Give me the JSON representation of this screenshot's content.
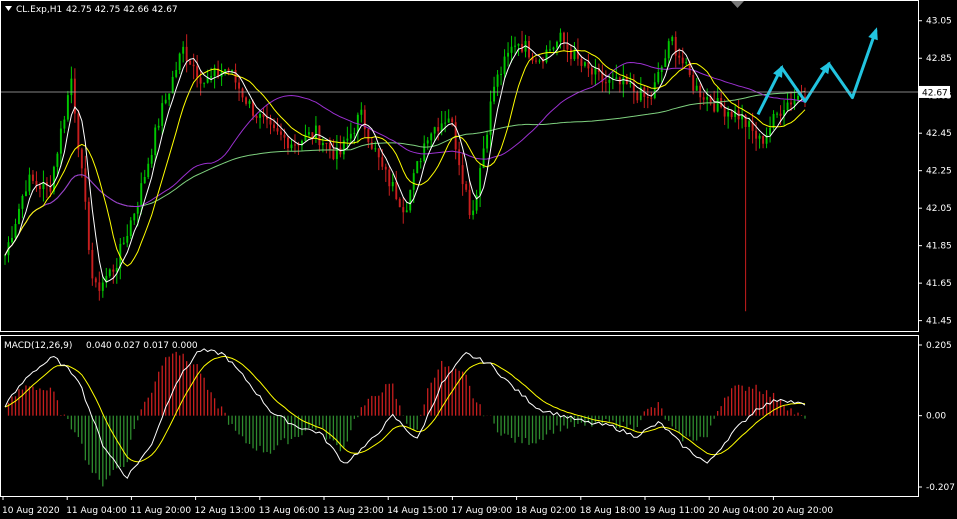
{
  "header": {
    "symbol_label": "CL.Exp,H1",
    "ohlc_label": "42.75 42.75 42.66 42.67"
  },
  "macd": {
    "label": "MACD(12,26,9)",
    "values_label": "0.040 0.027 0.017 0.000"
  },
  "current_price_label": "42.67",
  "colors": {
    "background": "#000000",
    "frame": "#ffffff",
    "bull_candle": "#00c800",
    "bear_candle": "#c81e1e",
    "fast_ma": "#ffffff",
    "slow_ma": "#ffff00",
    "ma_purple": "#9b30d0",
    "ma_green": "#7fd17f",
    "macd_line": "#ffffff",
    "signal_line": "#ffff00",
    "hist_pos": "#c81e1e",
    "hist_neg": "#2e8b2e",
    "forecast": "#22c4e0"
  },
  "chart_data": {
    "type": "candlestick",
    "price_axis_ticks": [
      "43.05",
      "42.85",
      "42.65",
      "42.45",
      "42.25",
      "42.05",
      "41.85",
      "41.65",
      "41.45"
    ],
    "price_range": [
      41.4,
      43.15
    ],
    "macd_axis_ticks": [
      "0.205",
      "0.00",
      "-0.207"
    ],
    "macd_range": [
      -0.207,
      0.205
    ],
    "time_labels": [
      "10 Aug 2020",
      "11 Aug 04:00",
      "11 Aug 20:00",
      "12 Aug 13:00",
      "13 Aug 06:00",
      "13 Aug 23:00",
      "14 Aug 15:00",
      "17 Aug 09:00",
      "18 Aug 02:00",
      "18 Aug 18:00",
      "19 Aug 11:00",
      "20 Aug 04:00",
      "20 Aug 20:00"
    ],
    "close_keypoints": [
      41.8,
      42.2,
      42.15,
      42.75,
      41.6,
      41.75,
      42.1,
      42.55,
      42.9,
      42.72,
      42.8,
      42.6,
      42.45,
      42.4,
      42.45,
      42.32,
      42.55,
      42.25,
      42.05,
      42.45,
      42.55,
      42.0,
      42.7,
      42.95,
      42.85,
      42.95,
      42.8,
      42.72,
      42.7,
      42.62,
      42.95,
      42.7,
      42.6,
      42.55,
      42.4,
      42.6,
      42.67
    ],
    "forecast_path": [
      42.55,
      42.8,
      42.62,
      42.82,
      42.64,
      43.0
    ],
    "macd_keypoints": [
      0.03,
      0.12,
      0.17,
      0.11,
      -0.08,
      -0.18,
      -0.09,
      0.09,
      0.19,
      0.18,
      0.1,
      0.01,
      -0.03,
      -0.05,
      -0.14,
      -0.08,
      0.0,
      -0.07,
      0.09,
      0.18,
      0.15,
      0.08,
      0.02,
      0.0,
      -0.02,
      -0.03,
      -0.06,
      -0.02,
      -0.09,
      -0.14,
      -0.05,
      0.02,
      0.05,
      0.03
    ]
  }
}
